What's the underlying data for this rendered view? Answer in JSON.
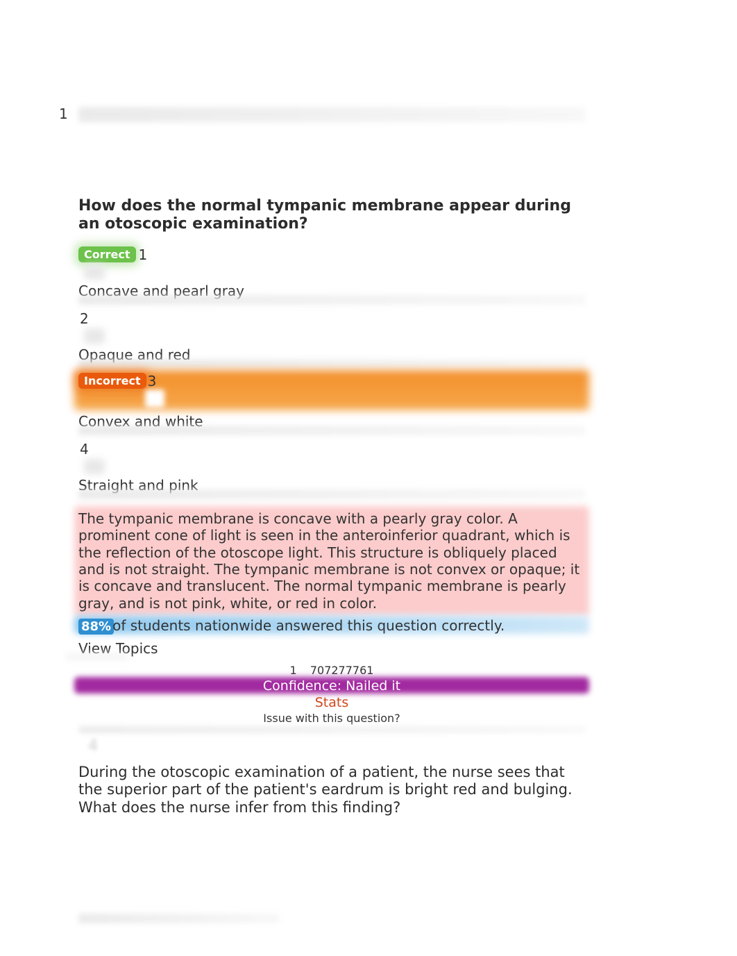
{
  "question_number": "1",
  "question_text": "How does the normal tympanic membrane appear during an otoscopic examination?",
  "badges": {
    "correct": "Correct",
    "incorrect": "Incorrect"
  },
  "options": {
    "o1": {
      "index": "1",
      "text": "Concave and pearl gray"
    },
    "o2": {
      "index": "2",
      "text": "Opaque and red"
    },
    "o3": {
      "index": "3",
      "text": "Convex and white"
    },
    "o4": {
      "index": "4",
      "text": "Straight and pink"
    }
  },
  "rationale": "The tympanic membrane is concave with a pearly gray color. A prominent cone of light is seen in the anteroinferior quadrant, which is the reflection of the otoscope light. This structure is obliquely placed and is not straight. The tympanic membrane is not convex or opaque; it is concave and translucent. The normal tympanic membrane is pearly gray, and is not pink, white, or red in color.",
  "stats": {
    "percent": "88%",
    "text": "of students nationwide answered this question correctly."
  },
  "view_topics_label": "View Topics",
  "meta": {
    "idx": "1",
    "code": "707277761"
  },
  "confidence": {
    "label": "Confidence: Nailed it"
  },
  "stats_link": "Stats",
  "issue_link": "Issue with this question?",
  "next_question_text": "During the otoscopic examination of a patient, the nurse sees that the superior part of the patient's eardrum is bright red and bulging. What does the nurse infer from this finding?"
}
